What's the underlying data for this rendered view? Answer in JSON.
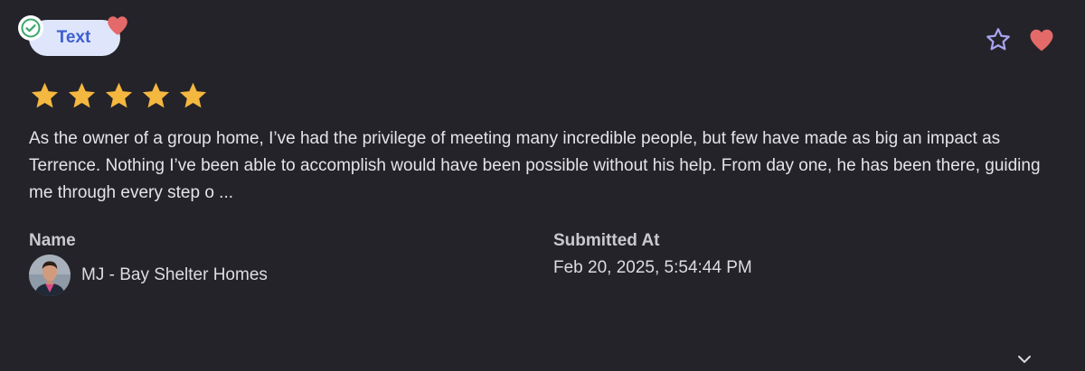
{
  "review": {
    "type_label": "Text",
    "rating": 5,
    "star_color": "#f4b73f",
    "text": "As the owner of a group home, I’ve had the privilege of meeting many incredible people, but few have made as big an impact as Terrence. Nothing I’ve been able to accomplish would have been possible without his help. From day one, he has been there, guiding me through every step o ...",
    "name_label": "Name",
    "author_name": "MJ - Bay Shelter Homes",
    "submitted_label": "Submitted At",
    "submitted_at": "Feb 20, 2025, 5:54:44 PM"
  },
  "colors": {
    "background": "#242329",
    "pill_bg": "#dfe6fb",
    "pill_text": "#3d5fcf",
    "heart": "#e46a6a",
    "star_outline": "#a8a3ee",
    "verified": "#3aa76d"
  },
  "icons": {
    "verified": "check-circle-icon",
    "favorite": "heart-icon",
    "star_action": "star-outline-icon",
    "rating": "star-icon",
    "expand": "chevron-down-icon"
  }
}
